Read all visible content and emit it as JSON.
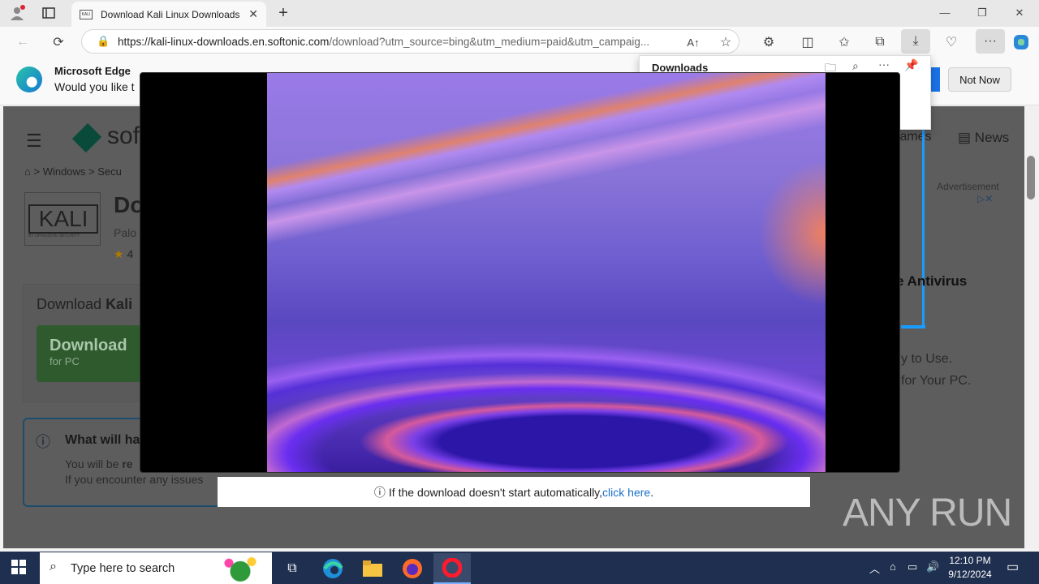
{
  "browser": {
    "tab_title": "Download Kali Linux Downloads",
    "tab_favicon_text": "KALI",
    "url_host": "https://kali-linux-downloads.en.softonic.com",
    "url_path": "/download?utm_source=bing&utm_medium=paid&utm_campaig...",
    "new_tab_glyph": "+",
    "read_aloud_glyph": "A↑"
  },
  "infobar": {
    "title": "Microsoft Edge",
    "message": "Would you like t",
    "not_now": "Not Now"
  },
  "downloads_panel": {
    "title": "Downloads"
  },
  "page": {
    "nav_logo": "sof",
    "breadcrumb": "> Windows > Secu",
    "app_logo": "KALI",
    "app_logo_sub": "BY OFFENSIVE SECURITY",
    "app_title": "Do",
    "app_publisher": "Palo",
    "rating": "4",
    "download_heading_prefix": "Download ",
    "download_heading_bold": "Kali",
    "download_button": "Download",
    "download_button_sub": "for PC",
    "info_title": "What will ha",
    "info_line1_prefix": "You will be ",
    "info_line1_bold": "re",
    "info_line2": "If you encounter any issues",
    "games_label": "Games",
    "news_label": "News",
    "advertisement": "Advertisement",
    "ad_title": "e Antivirus",
    "ad_line1": "y to Use.",
    "ad_line2": "for Your PC."
  },
  "download_notice": {
    "text": "If the download doesn't start automatically, ",
    "link": "click here",
    "suffix": "."
  },
  "watermark": "ANY RUN",
  "taskbar": {
    "search_placeholder": "Type here to search",
    "time": "12:10 PM",
    "date": "9/12/2024"
  }
}
